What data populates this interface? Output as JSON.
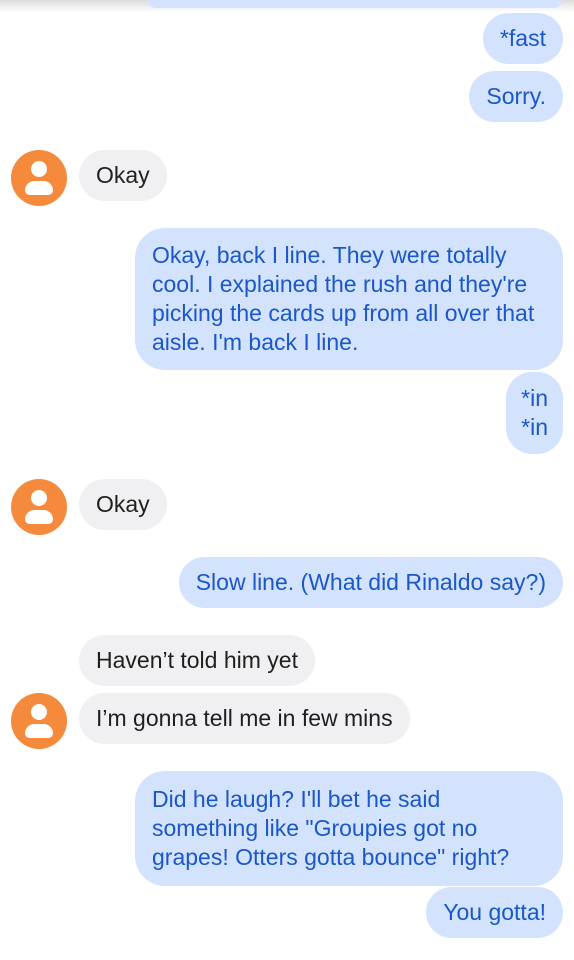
{
  "messages": [
    {
      "direction": "outgoing",
      "text": "*fast"
    },
    {
      "direction": "outgoing",
      "text": "Sorry."
    },
    {
      "direction": "incoming",
      "text": "Okay"
    },
    {
      "direction": "outgoing",
      "text": "Okay, back I line.  They were totally cool.  I explained the rush and they're picking the cards up from all over that aisle.  I'm back I line."
    },
    {
      "direction": "outgoing",
      "text": "*in\n*in"
    },
    {
      "direction": "incoming",
      "text": "Okay"
    },
    {
      "direction": "outgoing",
      "text": "Slow line.  (What did Rinaldo say?)"
    },
    {
      "direction": "incoming",
      "text": "Haven’t told him yet"
    },
    {
      "direction": "incoming",
      "text": "I’m gonna tell me in few mins"
    },
    {
      "direction": "outgoing",
      "text": "Did he laugh?  I'll bet he said something like \"Groupies got no grapes!  Otters gotta bounce\" right?"
    },
    {
      "direction": "outgoing",
      "text": "You gotta!"
    }
  ],
  "contact": {
    "avatar_icon": "person-icon",
    "avatar_color": "#f58a3c"
  },
  "colors": {
    "outgoing_bubble": "#d3e3fd",
    "outgoing_text": "#1a57c8",
    "incoming_bubble": "#f0f0f2",
    "incoming_text": "#1f1f1f"
  }
}
